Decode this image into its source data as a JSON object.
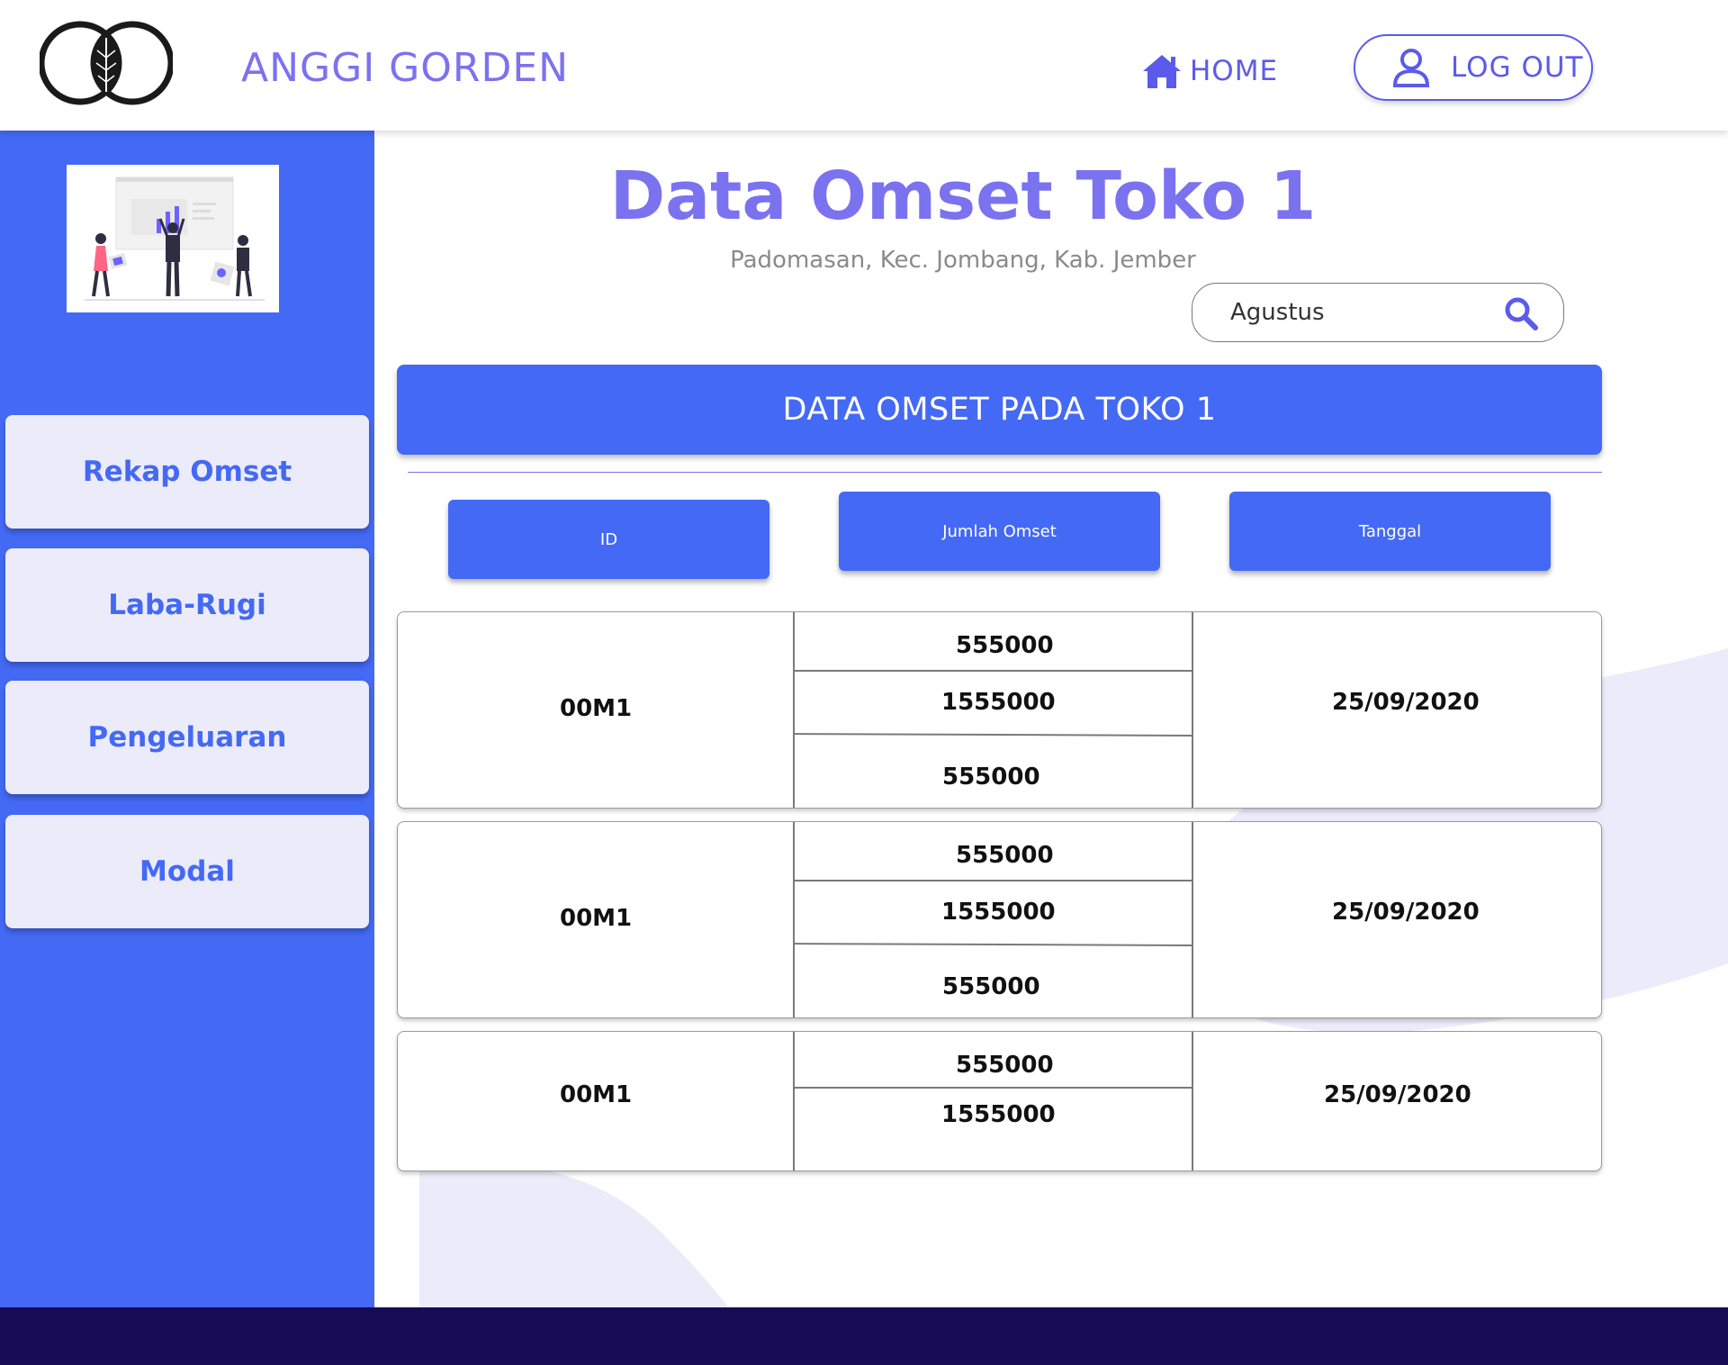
{
  "header": {
    "brand": "ANGGI GORDEN",
    "home_label": "HOME",
    "logout_label": "LOG OUT"
  },
  "sidebar": {
    "items": [
      {
        "label": "Rekap Omset"
      },
      {
        "label": "Laba-Rugi"
      },
      {
        "label": "Pengeluaran"
      },
      {
        "label": "Modal"
      }
    ]
  },
  "main": {
    "title": "Data Omset Toko 1",
    "subtitle": "Padomasan, Kec. Jombang, Kab. Jember",
    "search_value": "Agustus",
    "banner": "DATA OMSET PADA TOKO 1",
    "columns": [
      "ID",
      "Jumlah Omset",
      "Tanggal"
    ],
    "rows": [
      {
        "id": "00M1",
        "amounts": [
          "555000",
          "1555000",
          "555000"
        ],
        "date": "25/09/2020"
      },
      {
        "id": "00M1",
        "amounts": [
          "555000",
          "1555000",
          "555000"
        ],
        "date": "25/09/2020"
      },
      {
        "id": "00M1",
        "amounts": [
          "555000",
          "1555000"
        ],
        "date": "25/09/2020"
      }
    ]
  },
  "colors": {
    "primary": "#4469F4",
    "accent": "#7B72F0",
    "sidebar_button": "#ECEBFA",
    "footer": "#160B54"
  },
  "icons": [
    "logo-icon",
    "home-icon",
    "user-icon",
    "search-icon"
  ]
}
